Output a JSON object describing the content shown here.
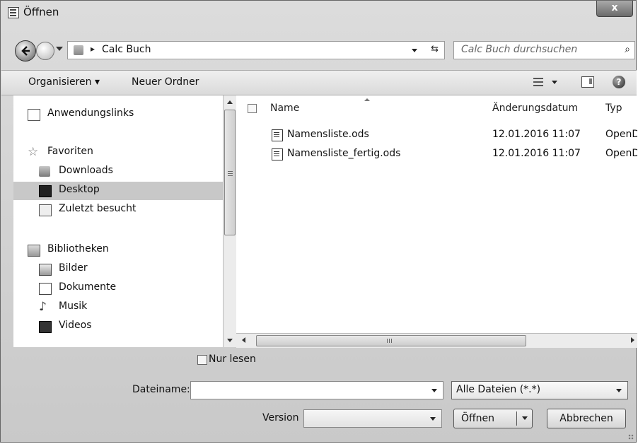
{
  "window": {
    "title": "Öffnen",
    "close_label": "x"
  },
  "nav": {
    "path": "Calc Buch",
    "search_placeholder": "Calc Buch durchsuchen"
  },
  "toolbar": {
    "organize_label": "Organisieren ▾",
    "new_folder_label": "Neuer Ordner",
    "help_label": "?"
  },
  "sidebar": {
    "items": [
      {
        "label": "Anwendungslinks",
        "icon": "page-icon"
      },
      {
        "label": "Favoriten",
        "icon": "star-icon"
      },
      {
        "label": "Downloads",
        "icon": "downloads-folder-icon"
      },
      {
        "label": "Desktop",
        "icon": "desktop-icon",
        "selected": true
      },
      {
        "label": "Zuletzt besucht",
        "icon": "recent-places-icon"
      },
      {
        "label": "Bibliotheken",
        "icon": "libraries-icon"
      },
      {
        "label": "Bilder",
        "icon": "pictures-icon"
      },
      {
        "label": "Dokumente",
        "icon": "documents-icon"
      },
      {
        "label": "Musik",
        "icon": "music-icon"
      },
      {
        "label": "Videos",
        "icon": "videos-icon"
      }
    ]
  },
  "file_list": {
    "columns": [
      "Name",
      "Änderungsdatum",
      "Typ"
    ],
    "rows": [
      {
        "name": "Namensliste.ods",
        "date": "12.01.2016 11:07",
        "type": "OpenD"
      },
      {
        "name": "Namensliste_fertig.ods",
        "date": "12.01.2016 11:07",
        "type": "OpenD"
      }
    ]
  },
  "bottom": {
    "read_only_label": "Nur lesen",
    "filename_label": "Dateiname:",
    "filename_value": "",
    "filter_value": "Alle Dateien (*.*)",
    "version_label": "Version",
    "version_value": "",
    "open_label": "Öffnen",
    "cancel_label": "Abbrechen"
  },
  "scroll": {
    "h_grip": "III"
  }
}
